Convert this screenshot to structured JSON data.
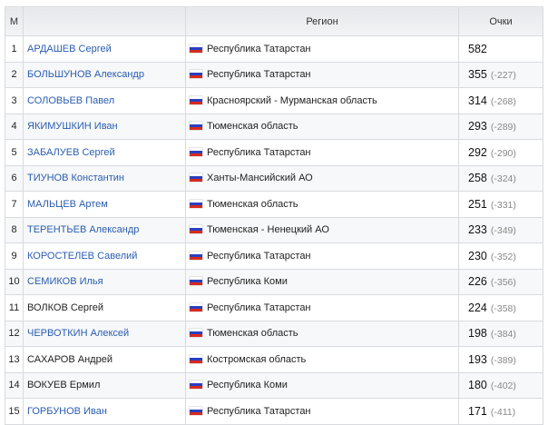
{
  "headers": {
    "place": "М",
    "name": "",
    "region": "Регион",
    "points": "Очки"
  },
  "rows": [
    {
      "place": "1",
      "name": "АРДАШЕВ Сергей",
      "link": true,
      "region": "Республика Татарстан",
      "points": "582",
      "diff": ""
    },
    {
      "place": "2",
      "name": "БОЛЬШУНОВ Александр",
      "link": true,
      "region": "Республика Татарстан",
      "points": "355",
      "diff": "(-227)"
    },
    {
      "place": "3",
      "name": "СОЛОВЬЕВ Павел",
      "link": true,
      "region": "Красноярский - Мурманская область",
      "points": "314",
      "diff": "(-268)"
    },
    {
      "place": "4",
      "name": "ЯКИМУШКИН Иван",
      "link": true,
      "region": "Тюменская область",
      "points": "293",
      "diff": "(-289)"
    },
    {
      "place": "5",
      "name": "ЗАБАЛУЕВ Сергей",
      "link": true,
      "region": "Республика Татарстан",
      "points": "292",
      "diff": "(-290)"
    },
    {
      "place": "6",
      "name": "ТИУНОВ Константин",
      "link": true,
      "region": "Ханты-Мансийский АО",
      "points": "258",
      "diff": "(-324)"
    },
    {
      "place": "7",
      "name": "МАЛЬЦЕВ Артем",
      "link": true,
      "region": "Тюменская область",
      "points": "251",
      "diff": "(-331)"
    },
    {
      "place": "8",
      "name": "ТЕРЕНТЬЕВ Александр",
      "link": true,
      "region": "Тюменская - Ненецкий АО",
      "points": "233",
      "diff": "(-349)"
    },
    {
      "place": "9",
      "name": "КОРОСТЕЛЕВ Савелий",
      "link": true,
      "region": "Республика Татарстан",
      "points": "230",
      "diff": "(-352)"
    },
    {
      "place": "10",
      "name": "СЕМИКОВ Илья",
      "link": true,
      "region": "Республика Коми",
      "points": "226",
      "diff": "(-356)"
    },
    {
      "place": "11",
      "name": "ВОЛКОВ Сергей",
      "link": false,
      "region": "Республика Татарстан",
      "points": "224",
      "diff": "(-358)"
    },
    {
      "place": "12",
      "name": "ЧЕРВОТКИН Алексей",
      "link": true,
      "region": "Тюменская область",
      "points": "198",
      "diff": "(-384)"
    },
    {
      "place": "13",
      "name": "САХАРОВ Андрей",
      "link": false,
      "region": "Костромская область",
      "points": "193",
      "diff": "(-389)"
    },
    {
      "place": "14",
      "name": "ВОКУЕВ Ермил",
      "link": false,
      "region": "Республика Коми",
      "points": "180",
      "diff": "(-402)"
    },
    {
      "place": "15",
      "name": "ГОРБУНОВ Иван",
      "link": true,
      "region": "Республика Татарстан",
      "points": "171",
      "diff": "(-411)"
    }
  ]
}
